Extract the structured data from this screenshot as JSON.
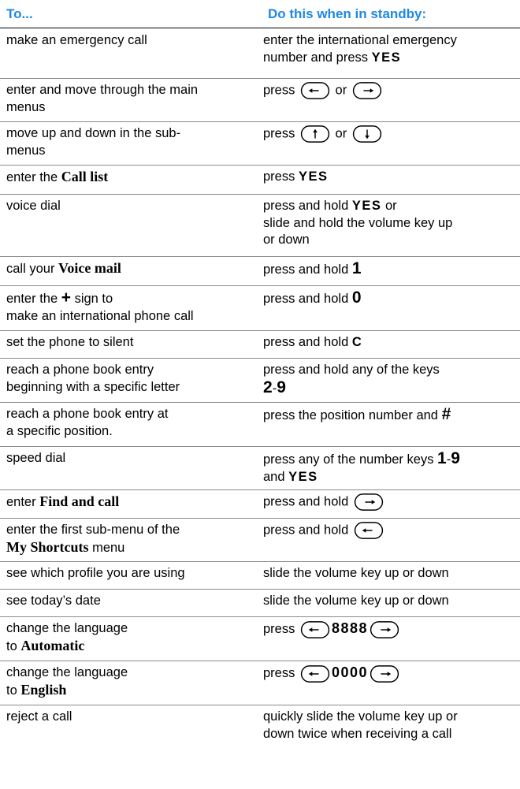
{
  "header": {
    "col1": "To...",
    "col2": "Do this when in standby:",
    "accent": "#1e88e5"
  },
  "rows": [
    {
      "c1a": "make an emergency call",
      "c2a": "enter the international emergency",
      "c2b": "number and press ",
      "c2c": "YES"
    },
    {
      "c1a": "enter and move through the main",
      "c1b": "menus",
      "c2a": "press ",
      "c2b": " or "
    },
    {
      "c1a": "move up and down in the sub-",
      "c1b": "menus",
      "c2a": "press ",
      "c2b": " or "
    },
    {
      "c1a": "enter the ",
      "c1b": "Call list",
      "c2a": "press ",
      "c2b": "YES"
    },
    {
      "c1a": "voice dial",
      "c2a": "press and hold ",
      "c2b": "YES",
      "c2c": " or",
      "c2d": "slide and hold the volume key up",
      "c2e": "or down"
    },
    {
      "c1a": "call your ",
      "c1b": "Voice mail",
      "c2a": "press and hold ",
      "c2b": "1"
    },
    {
      "c1a": "enter the ",
      "c1b": "+",
      "c1c": " sign to",
      "c1d": "make an international phone call",
      "c2a": "press and hold ",
      "c2b": "0"
    },
    {
      "c1a": "set the phone to silent",
      "c2a": "press and hold ",
      "c2b": "C"
    },
    {
      "c1a": "reach a phone book entry",
      "c1b": "beginning with a specific letter",
      "c2a": "press and hold any of the keys",
      "c2b": "2",
      "c2c": "-",
      "c2d": "9"
    },
    {
      "c1a": "reach a phone book entry at",
      "c1b": "a specific position.",
      "c2a": "press the position number and ",
      "c2b": "#"
    },
    {
      "c1a": "speed dial",
      "c2a": "press any of the number keys ",
      "c2b": "1",
      "c2c": "-",
      "c2d": "9",
      "c2e": "and ",
      "c2f": "YES"
    },
    {
      "c1a": "enter ",
      "c1b": "Find and call",
      "c2a": "press and hold "
    },
    {
      "c1a": "enter the first sub-menu of the",
      "c1b": "My Shortcuts",
      "c1c": " menu",
      "c2a": "press and hold "
    },
    {
      "c1a": "see which profile you are using",
      "c2a": "slide the volume key up or down"
    },
    {
      "c1a": "see today’s date",
      "c2a": "slide the volume key up or down"
    },
    {
      "c1a": "change the language",
      "c1b": "to ",
      "c1c": "Automatic",
      "c2a": "press ",
      "c2b": "8888"
    },
    {
      "c1a": "change the language",
      "c1b": "to ",
      "c1c": "English",
      "c2a": "press ",
      "c2b": "0000"
    },
    {
      "c1a": "reject a call",
      "c2a": "quickly slide the volume key up or",
      "c2b": "down twice when receiving a call"
    }
  ],
  "icons": {
    "left": "left-arrow-key-icon",
    "right": "right-arrow-key-icon",
    "up": "up-arrow-key-icon",
    "down": "down-arrow-key-icon"
  }
}
